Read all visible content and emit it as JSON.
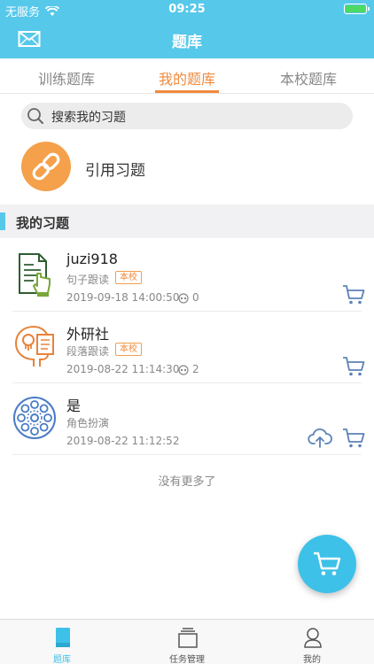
{
  "status_bar": {
    "carrier": "无服务",
    "time": "09:25"
  },
  "nav": {
    "title": "题库"
  },
  "tabs": [
    {
      "label": "训练题库",
      "active": false
    },
    {
      "label": "我的题库",
      "active": true
    },
    {
      "label": "本校题库",
      "active": false
    }
  ],
  "search": {
    "placeholder": "搜索我的习题"
  },
  "cite": {
    "label": "引用习题"
  },
  "section": {
    "title": "我的习题"
  },
  "items": [
    {
      "title": "juzi918",
      "type": "句子跟读",
      "badge": "本校",
      "date": "2019-09-18  14:00:50",
      "views": "0",
      "icon": "document-hand-icon"
    },
    {
      "title": "外研社",
      "type": "段落跟读",
      "badge": "本校",
      "date": "2019-08-22  11:14:30",
      "views": "2",
      "icon": "head-speaking-icon"
    },
    {
      "title": "是",
      "type": "角色扮演",
      "date": "2019-08-22  11:12:52",
      "icon": "reel-icon"
    }
  ],
  "list_footer": "没有更多了",
  "tabbar": [
    {
      "label": "题库",
      "active": true
    },
    {
      "label": "任务管理",
      "active": false
    },
    {
      "label": "我的",
      "active": false
    }
  ],
  "colors": {
    "primary": "#56c8ea",
    "accent": "#f08a3c",
    "cite_circle": "#f5a04a",
    "fab": "#3ec1e8"
  }
}
